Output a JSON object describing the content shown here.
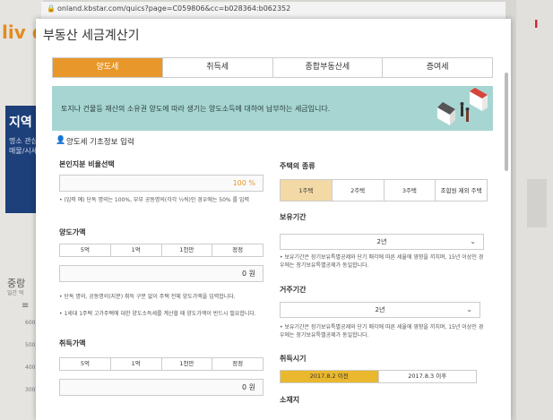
{
  "browser": {
    "url": "onland.kbstar.com/quics?page=C059806&cc=b028364:b062352"
  },
  "background": {
    "logo": "liv d",
    "region": "지역",
    "region_sub": "명소 관심 매물/시세",
    "mid_label": "중랑",
    "mid_sub": "일간 억",
    "axis": [
      "600",
      "500",
      "400",
      "300",
      "200"
    ],
    "right_logo": "I"
  },
  "popup": {
    "title": "부동산 세금계산기",
    "tabs": [
      {
        "label": "양도세",
        "active": true
      },
      {
        "label": "취득세",
        "active": false
      },
      {
        "label": "종합부동산세",
        "active": false
      },
      {
        "label": "증여세",
        "active": false
      }
    ],
    "banner_text": "토지나 건물등 재산의 소유권 양도에 따라 생기는 양도소득에 대하여 납부하는 세금입니다.",
    "section_title": "양도세 기초정보 입력",
    "ownership": {
      "label": "본인지분 비율선택",
      "value": "100 %",
      "note": "• (입력 예) 단독 명의는 100%, 부부 공동명의(각각 ½씩)인 경우에는 50% 를 입력"
    },
    "sale_price": {
      "label": "양도가액",
      "quick": [
        "5억",
        "1억",
        "1천만",
        "정정"
      ],
      "value": "0 원",
      "note1": "• 단독 명의, 공동명의(지분) 취득 구분 없이 주택 전체 양도가액을 입력합니다.",
      "note2": "• 1세대 1주택 고가주택에 대한 양도소득세를 계산할 때 양도가액이 반드시 필요합니다."
    },
    "acquisition_price": {
      "label": "취득가액",
      "quick": [
        "5억",
        "1억",
        "1천만",
        "정정"
      ],
      "value": "0 원"
    },
    "house_type": {
      "label": "주택의 종류",
      "options": [
        "1주택",
        "2주택",
        "3주택",
        "조합원 제외 주택"
      ],
      "selected": "1주택"
    },
    "holding_period": {
      "label": "보유기간",
      "value": "2년",
      "note": "• 보유기간은 장기보유특별공제와 단기 매각에 따른 세율에 영향을 끼치며, 15년 이상인 경우에는 장기보유특별공제가 동일합니다."
    },
    "residence_period": {
      "label": "거주기간",
      "value": "2년",
      "note": "• 보유기간은 장기보유특별공제와 단기 매각에 따른 세율에 영향을 끼치며, 15년 이상인 경우에는 장기보유특별공제가 동일합니다."
    },
    "acquisition_time": {
      "label": "취득시기",
      "options": [
        "2017.8.2 이전",
        "2017.8.3 이후"
      ],
      "selected": "2017.8.2 이전"
    },
    "location_label": "소재지"
  },
  "colors": {
    "accent": "#e8972a",
    "banner": "#a7d6d2",
    "selected_time": "#e9b82e"
  }
}
